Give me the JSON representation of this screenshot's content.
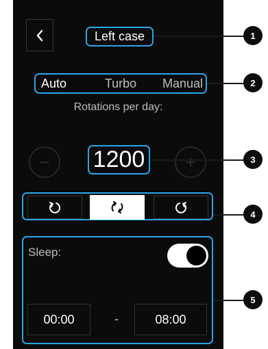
{
  "header": {
    "title": "Left case"
  },
  "modes": {
    "items": [
      "Auto",
      "Turbo",
      "Manual"
    ],
    "selected": "Auto"
  },
  "rotations": {
    "label": "Rotations per day:",
    "value": "1200",
    "minus": "−",
    "plus": "+"
  },
  "direction": {
    "options": [
      "counterclockwise",
      "both",
      "clockwise"
    ],
    "selected": "both"
  },
  "sleep": {
    "label": "Sleep:",
    "enabled": true,
    "start": "00:00",
    "separator": "-",
    "end": "08:00"
  },
  "callouts": [
    "1",
    "2",
    "3",
    "4",
    "5"
  ],
  "colors": {
    "highlight": "#2aa5e8",
    "screen": "#0b0b0b",
    "selected_bg": "#ffffff"
  }
}
